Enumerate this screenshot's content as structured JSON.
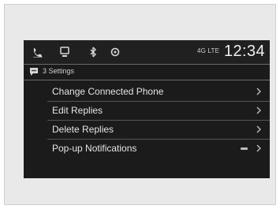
{
  "status_bar": {
    "icons": [
      "phone-icon",
      "media-icon",
      "bluetooth-icon",
      "settings-icon"
    ],
    "signal_text": "4G LTE",
    "time": "12:34"
  },
  "breadcrumb": {
    "icon": "message-icon",
    "text": "3 Settings"
  },
  "menu": {
    "items": [
      {
        "label": "Change Connected Phone"
      },
      {
        "label": "Edit Replies"
      },
      {
        "label": "Delete Replies"
      },
      {
        "label": "Pop-up Notifications",
        "toggle_state": "on"
      }
    ]
  },
  "colors": {
    "screen_background": "#1b1b1b",
    "text": "#e4e4e4",
    "frame_background": "#e9e9e9"
  }
}
